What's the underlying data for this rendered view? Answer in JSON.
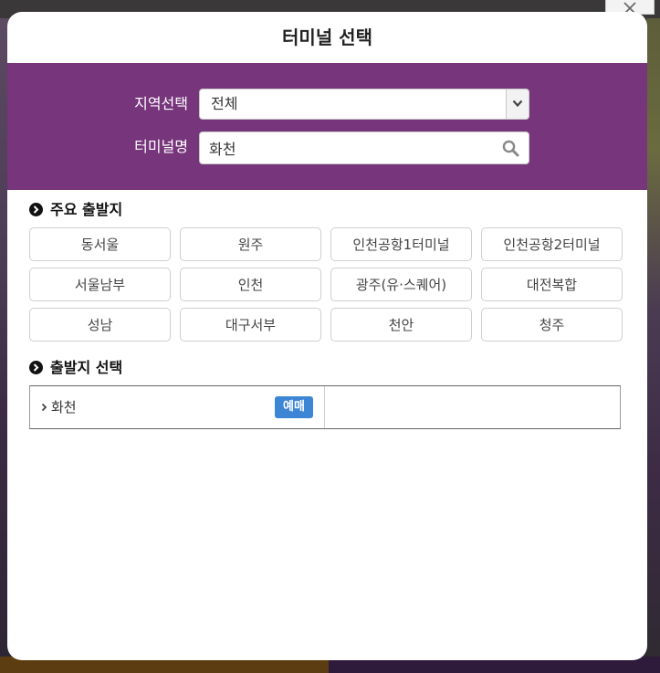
{
  "modal": {
    "title": "터미널 선택",
    "close_icon": "close-icon"
  },
  "search": {
    "region_label": "지역선택",
    "region_value": "전체",
    "terminal_label": "터미널명",
    "terminal_value": "화천"
  },
  "major_departures": {
    "title": "주요 출발지",
    "items": [
      "동서울",
      "원주",
      "인천공항1터미널",
      "인천공항2터미널",
      "서울남부",
      "인천",
      "광주(유·스퀘어)",
      "대전복합",
      "성남",
      "대구서부",
      "천안",
      "청주"
    ]
  },
  "departure_select": {
    "title": "출발지 선택",
    "results": [
      {
        "name": "화천",
        "badge": "예매"
      }
    ]
  },
  "colors": {
    "band": "#77357c",
    "badge": "#3d86d6"
  }
}
